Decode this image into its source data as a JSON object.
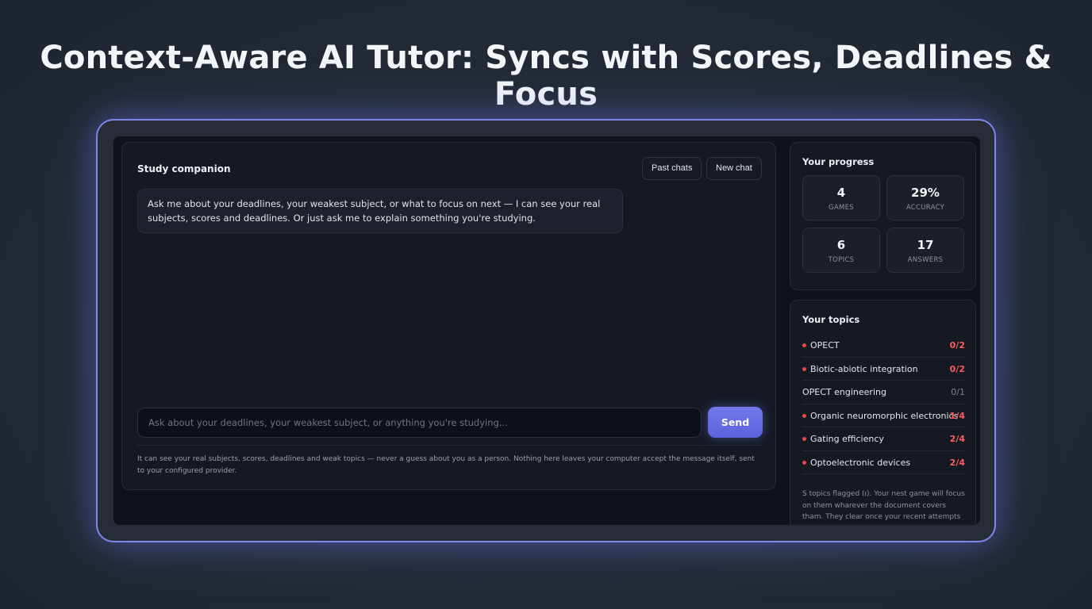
{
  "headline": "Context-Aware AI Tutor: Syncs with Scores, Deadlines & Focus",
  "chat": {
    "title": "Study companion",
    "past_chats_label": "Past chats",
    "new_chat_label": "New chat",
    "assistant_message": "Ask me about your deadlines, your weakest subject, or what to focus on next — I can see your real subjects, scores and deadlines. Or just ask me to explain something you're studying.",
    "input_placeholder": "Ask about your deadlines, your weakest subject, or anything you're studying...",
    "send_label": "Send",
    "privacy_note": "It can see your real subjects, scores, deadlines and weak topics — never a guess about you as a person. Nothing here leaves your computer accept the message itself, sent to your configured provider."
  },
  "progress": {
    "title": "Your progress",
    "stats": [
      {
        "value": "4",
        "label": "GAMES"
      },
      {
        "value": "29%",
        "label": "ACCURACY"
      },
      {
        "value": "6",
        "label": "TOPICS"
      },
      {
        "value": "17",
        "label": "ANSWERS"
      }
    ]
  },
  "topics": {
    "title": "Your topics",
    "items": [
      {
        "name": "OPECT",
        "score": "0/2",
        "flagged": true
      },
      {
        "name": "Biotic-abiotic integration",
        "score": "0/2",
        "flagged": true
      },
      {
        "name": "OPECT engineering",
        "score": "0/1",
        "flagged": false
      },
      {
        "name": "Organic neuromorphic electronics",
        "score": "1/4",
        "flagged": true
      },
      {
        "name": "Gating efficiency",
        "score": "2/4",
        "flagged": true
      },
      {
        "name": "Optoelectronic devices",
        "score": "2/4",
        "flagged": true
      }
    ],
    "note": "S topics flagged (ı). Your nest game will focus on them wharever the document covers tham. They clear once your recent attempts improve."
  },
  "colors": {
    "accent": "#6b73e8",
    "flag_red": "#e5484d",
    "background": "#232a36"
  }
}
